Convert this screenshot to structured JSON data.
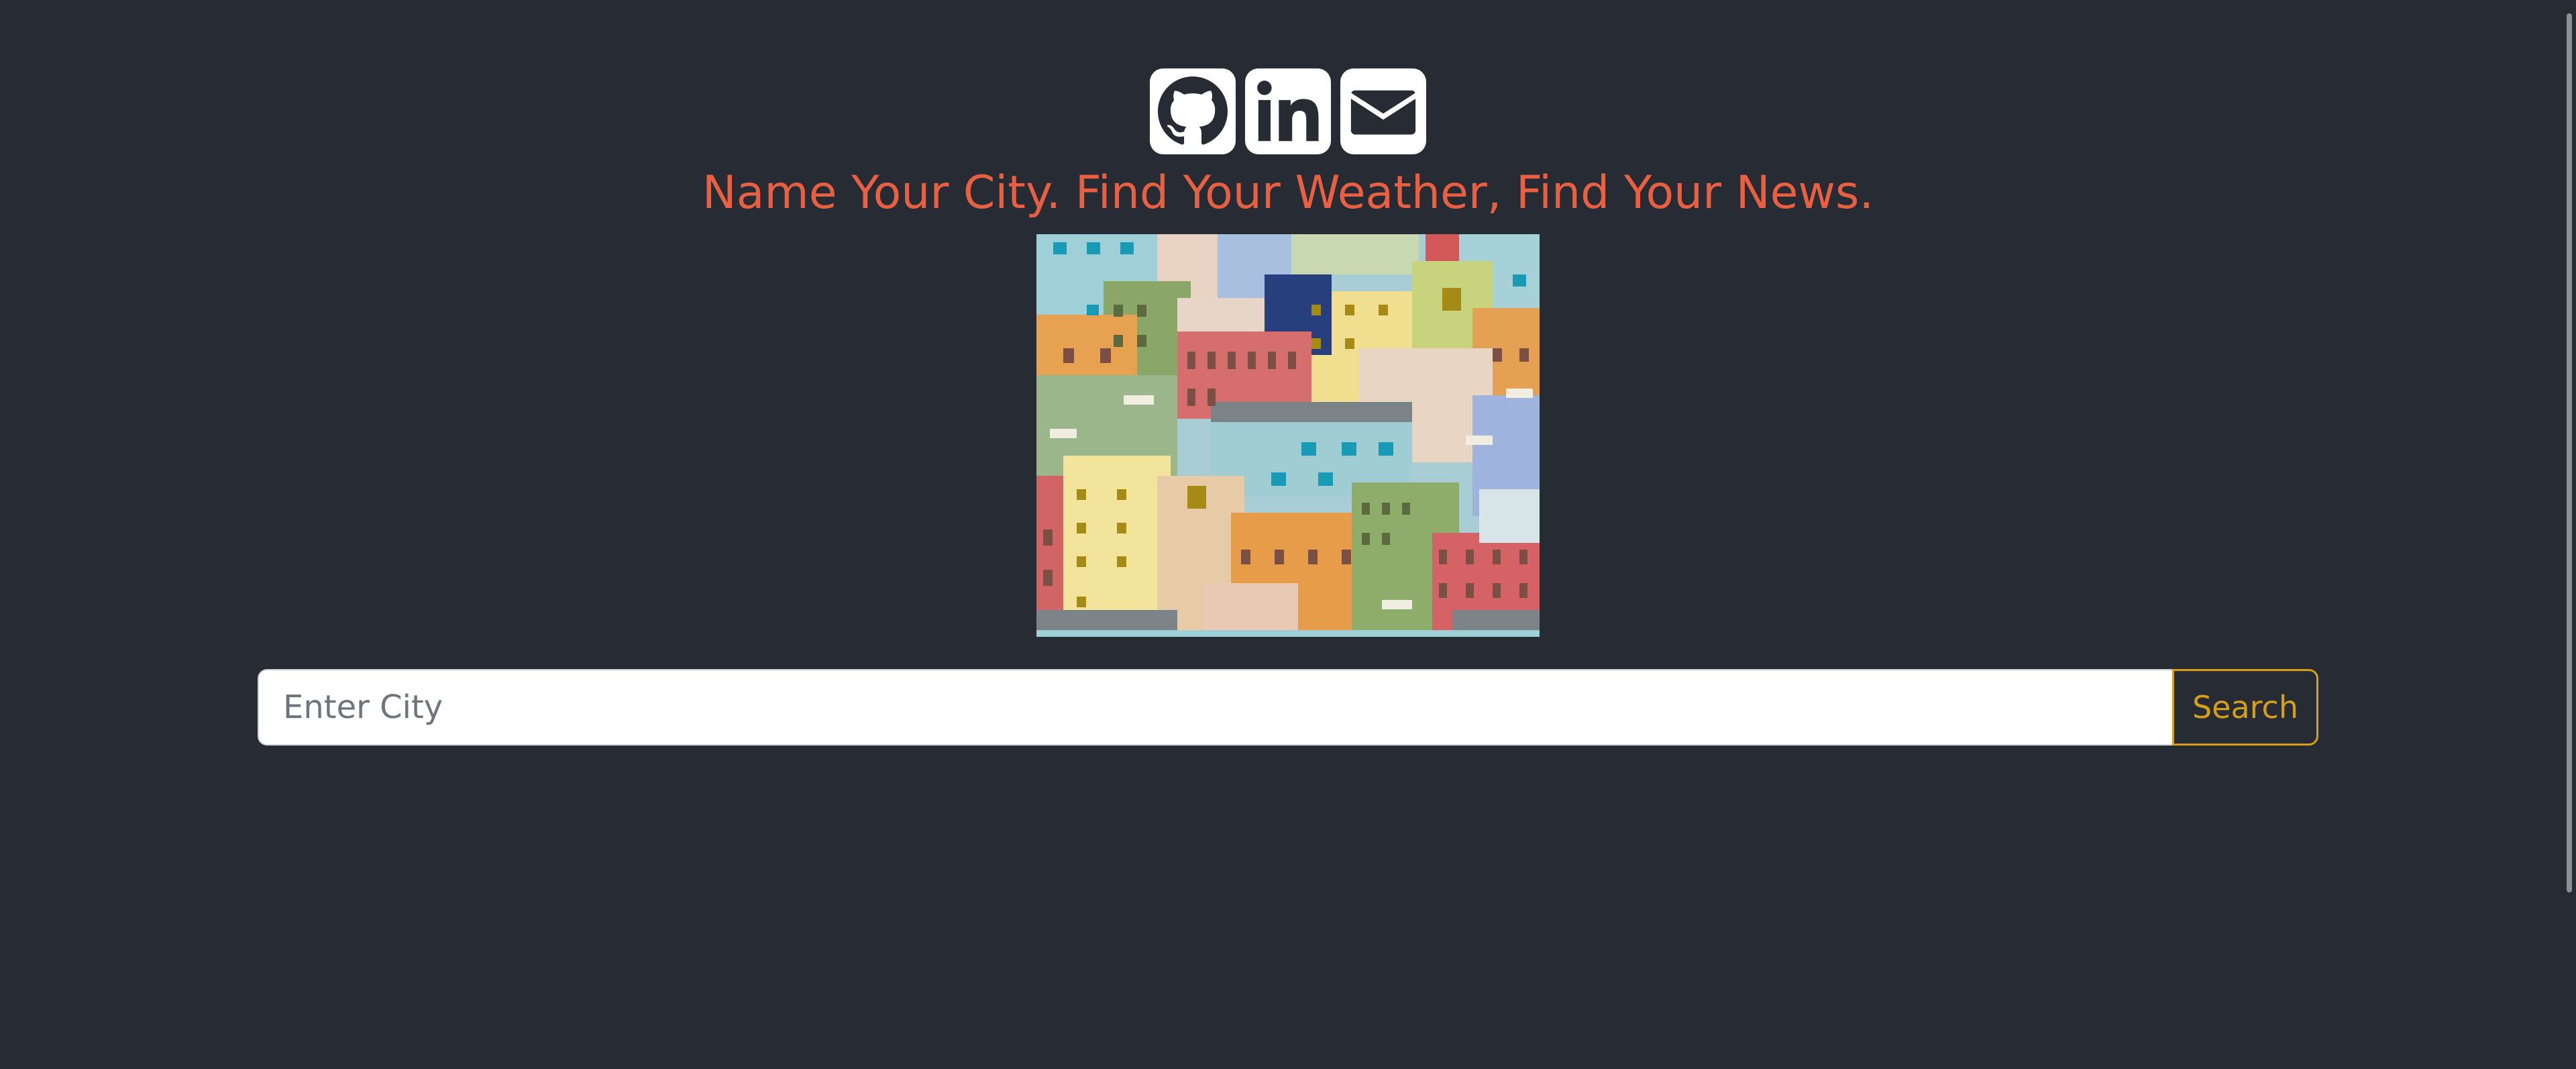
{
  "social": {
    "links": [
      {
        "name": "GitHub",
        "icon": "github-icon"
      },
      {
        "name": "LinkedIn",
        "icon": "linkedin-icon"
      },
      {
        "name": "Email",
        "icon": "envelope-icon"
      }
    ]
  },
  "headline": "Name Your City. Find Your Weather, Find Your News.",
  "hero": {
    "alt": "Illustration of colorful city buildings"
  },
  "search": {
    "placeholder": "Enter City",
    "value": "",
    "button_label": "Search"
  },
  "colors": {
    "background": "#272b33",
    "headline": "#e85f42",
    "accent": "#d4a017",
    "icon_bg": "#ffffff"
  }
}
